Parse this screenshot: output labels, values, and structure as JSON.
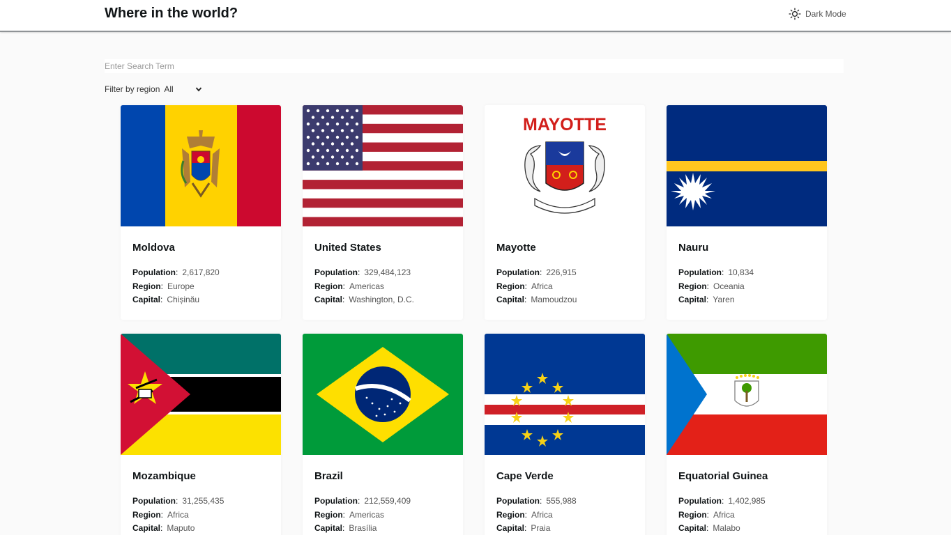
{
  "header": {
    "title": "Where in the world?",
    "dark_mode_label": "Dark Mode"
  },
  "search": {
    "placeholder": "Enter Search Term"
  },
  "filter": {
    "label": "Filter by region",
    "selected": "All"
  },
  "labels": {
    "population": "Population",
    "region": "Region",
    "capital": "Capital"
  },
  "flag_text": {
    "mayotte": "MAYOTTE"
  },
  "countries": [
    {
      "name": "Moldova",
      "population": "2,617,820",
      "region": "Europe",
      "capital": "Chișinău"
    },
    {
      "name": "United States",
      "population": "329,484,123",
      "region": "Americas",
      "capital": "Washington, D.C."
    },
    {
      "name": "Mayotte",
      "population": "226,915",
      "region": "Africa",
      "capital": "Mamoudzou"
    },
    {
      "name": "Nauru",
      "population": "10,834",
      "region": "Oceania",
      "capital": "Yaren"
    },
    {
      "name": "Mozambique",
      "population": "31,255,435",
      "region": "Africa",
      "capital": "Maputo"
    },
    {
      "name": "Brazil",
      "population": "212,559,409",
      "region": "Americas",
      "capital": "Brasília"
    },
    {
      "name": "Cape Verde",
      "population": "555,988",
      "region": "Africa",
      "capital": "Praia"
    },
    {
      "name": "Equatorial Guinea",
      "population": "1,402,985",
      "region": "Africa",
      "capital": "Malabo"
    }
  ]
}
